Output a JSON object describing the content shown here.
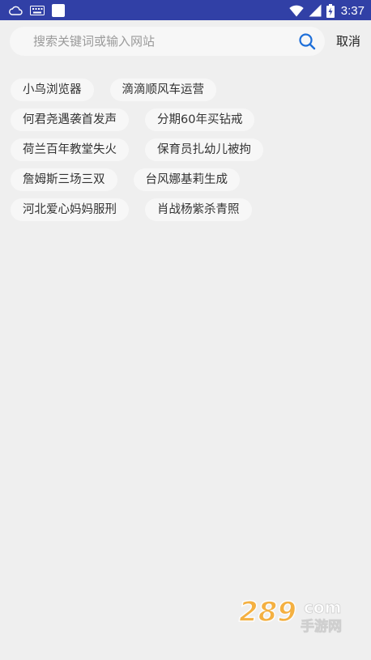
{
  "status_bar": {
    "time": "3:37",
    "background": "#3140a6",
    "left_icons": [
      "cloud-icon",
      "keyboard-icon",
      "notification-square-icon"
    ],
    "right_icons": [
      "wifi-icon",
      "signal-icon",
      "battery-charging-icon"
    ]
  },
  "search": {
    "placeholder": "搜索关键词或输入网站",
    "cancel_label": "取消",
    "icon": "search-icon",
    "icon_color": "#1e6fd9"
  },
  "hot_tags": [
    [
      "小鸟浏览器",
      "滴滴顺风车运营"
    ],
    [
      "何君尧遇袭首发声",
      "分期60年买钻戒"
    ],
    [
      "荷兰百年教堂失火",
      "保育员扎幼儿被拘"
    ],
    [
      "詹姆斯三场三双",
      "台风娜基莉生成"
    ],
    [
      "河北爱心妈妈服刑",
      "肖战杨紫杀青照"
    ]
  ],
  "watermark": {
    "logo_text": "289",
    "domain_suffix": "com",
    "tagline": "手游网"
  }
}
